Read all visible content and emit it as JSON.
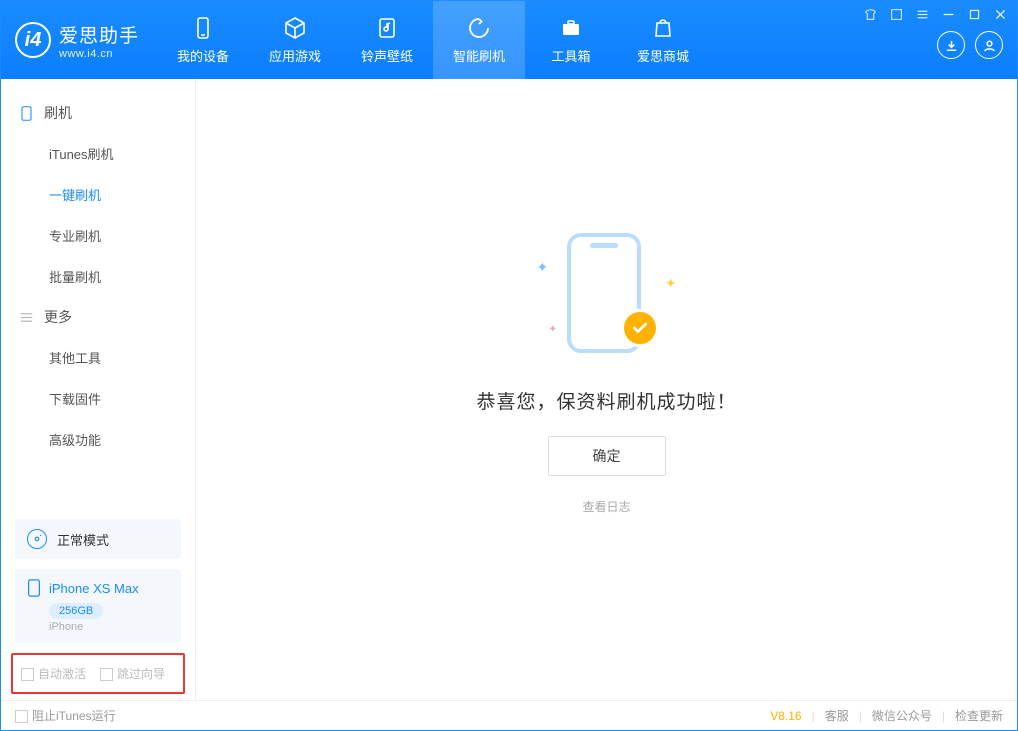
{
  "app": {
    "name_cn": "爱思助手",
    "url": "www.i4.cn"
  },
  "nav": {
    "tabs": [
      {
        "label": "我的设备",
        "icon": "phone-icon"
      },
      {
        "label": "应用游戏",
        "icon": "cube-icon"
      },
      {
        "label": "铃声壁纸",
        "icon": "music-icon"
      },
      {
        "label": "智能刷机",
        "icon": "refresh-icon",
        "active": true
      },
      {
        "label": "工具箱",
        "icon": "toolbox-icon"
      },
      {
        "label": "爱思商城",
        "icon": "bag-icon"
      }
    ]
  },
  "sidebar": {
    "groups": [
      {
        "title": "刷机",
        "items": [
          {
            "label": "iTunes刷机"
          },
          {
            "label": "一键刷机",
            "active": true
          },
          {
            "label": "专业刷机"
          },
          {
            "label": "批量刷机"
          }
        ]
      },
      {
        "title": "更多",
        "items": [
          {
            "label": "其他工具"
          },
          {
            "label": "下载固件"
          },
          {
            "label": "高级功能"
          }
        ]
      }
    ],
    "mode_label": "正常模式",
    "device": {
      "name": "iPhone XS Max",
      "storage": "256GB",
      "type": "iPhone"
    },
    "options": {
      "auto_activate": "自动激活",
      "skip_wizard": "跳过向导"
    }
  },
  "main": {
    "success_message": "恭喜您，保资料刷机成功啦！",
    "confirm_label": "确定",
    "view_log_label": "查看日志"
  },
  "statusbar": {
    "block_itunes": "阻止iTunes运行",
    "version": "V8.16",
    "links": [
      "客服",
      "微信公众号",
      "检查更新"
    ]
  }
}
